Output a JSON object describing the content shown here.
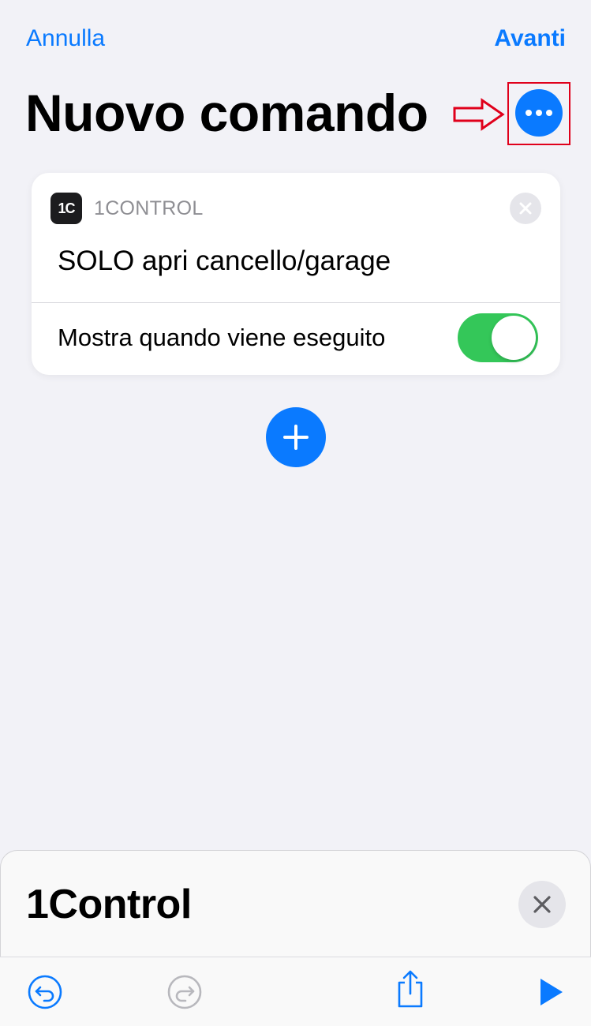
{
  "nav": {
    "cancel_label": "Annulla",
    "next_label": "Avanti"
  },
  "page": {
    "title": "Nuovo comando"
  },
  "annotation": {
    "color": "#e0001b",
    "arrow_icon": "right-arrow-outline-icon"
  },
  "action_card": {
    "app_logo_text": "1C",
    "app_name": "1CONTROL",
    "action_title": "SOLO apri cancello/garage",
    "show_when_run_label": "Mostra quando viene eseguito",
    "show_when_run_enabled": true
  },
  "bottom_sheet": {
    "title": "1Control"
  },
  "toolbar": {
    "icons": [
      "undo-icon",
      "redo-icon",
      "share-icon",
      "play-icon"
    ]
  },
  "colors": {
    "accent": "#0a7aff",
    "toggle_on": "#34c759",
    "background": "#f2f2f7"
  }
}
